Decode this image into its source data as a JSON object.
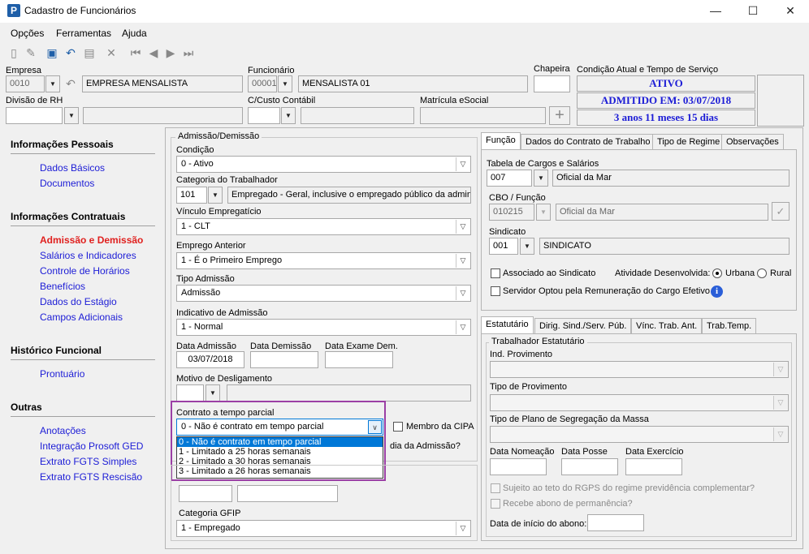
{
  "window": {
    "title": "Cadastro de Funcionários",
    "minimize": "—",
    "maximize": "☐",
    "close": "✕"
  },
  "menu": {
    "opcoes": "Opções",
    "ferramentas": "Ferramentas",
    "ajuda": "Ajuda"
  },
  "header": {
    "empresa_label": "Empresa",
    "empresa_code": "0010",
    "empresa_name": "EMPRESA MENSALISTA",
    "funcionario_label": "Funcionário",
    "funcionario_code": "00001",
    "funcionario_name": "MENSALISTA 01",
    "chapeira_label": "Chapeira",
    "chapeira_value": "",
    "condicao_label": "Condição Atual e Tempo de Serviço",
    "status_ativo": "ATIVO",
    "status_admitido": "ADMITIDO EM: 03/07/2018",
    "status_tempo": "3 anos 11 meses 15 dias",
    "divisao_label": "Divisão de RH",
    "divisao_value": "",
    "custo_label": "C/Custo Contábil",
    "custo_value": "",
    "matricula_label": "Matrícula eSocial",
    "matricula_value": ""
  },
  "sidebar": {
    "sec1": "Informações Pessoais",
    "dados_basicos": "Dados Básicos",
    "documentos": "Documentos",
    "sec2": "Informações Contratuais",
    "admissao": "Admissão e Demissão",
    "salarios": "Salários e Indicadores",
    "horarios": "Controle de Horários",
    "beneficios": "Benefícios",
    "estagio": "Dados do Estágio",
    "campos": "Campos Adicionais",
    "sec3": "Histórico Funcional",
    "prontuario": "Prontuário",
    "sec4": "Outras",
    "anotacoes": "Anotações",
    "integracao": "Integração Prosoft GED",
    "extrato": "Extrato FGTS Simples",
    "extrato_rescisao": "Extrato FGTS Rescisão"
  },
  "admissao": {
    "group_title": "Admissão/Demissão",
    "condicao_label": "Condição",
    "condicao_value": "0 - Ativo",
    "categoria_label": "Categoria do Trabalhador",
    "categoria_code": "101",
    "categoria_desc": "Empregado - Geral, inclusive o empregado público da administ",
    "vinculo_label": "Vínculo Empregatício",
    "vinculo_value": "1 - CLT",
    "emprego_label": "Emprego Anterior",
    "emprego_value": "1 - É o Primeiro Emprego",
    "tipo_label": "Tipo Admissão",
    "tipo_value": "Admissão",
    "indicativo_label": "Indicativo de Admissão",
    "indicativo_value": "1 - Normal",
    "data_adm_label": "Data Admissão",
    "data_adm_value": "03/07/2018",
    "data_dem_label": "Data Demissão",
    "data_dem_value": "",
    "data_exame_label": "Data Exame Dem.",
    "data_exame_value": "",
    "motivo_label": "Motivo de Desligamento",
    "contrato_label": "Contrato a tempo parcial",
    "contrato_value": "0 - Não é contrato em tempo parcial",
    "contrato_options": [
      "0 - Não é contrato em tempo parcial",
      "1 - Limitado a 25 horas semanais",
      "2 - Limitado a 30 horas semanais",
      "3 - Limitado a 26 horas semanais"
    ],
    "membro_cipa": "Membro da CIPA",
    "dia_admissao": "dia da Admissão?",
    "categoria_gfip_label": "Categoria GFIP",
    "categoria_gfip_value": "1 - Empregado"
  },
  "funcao_tabs": {
    "t1": "Função",
    "t2": "Dados do Contrato de Trabalho",
    "t3": "Tipo de Regime",
    "t4": "Observações"
  },
  "funcao": {
    "tabela_label": "Tabela de Cargos e Salários",
    "tabela_code": "007",
    "tabela_desc": "Oficial da Mar",
    "cbo_label": "CBO / Função",
    "cbo_code": "010215",
    "cbo_desc": "Oficial da Mar",
    "sindicato_label": "Sindicato",
    "sindicato_code": "001",
    "sindicato_desc": "SINDICATO",
    "associado": "Associado ao Sindicato",
    "atividade_label": "Atividade Desenvolvida:",
    "urbana": "Urbana",
    "rural": "Rural",
    "servidor": "Servidor Optou pela Remuneração do Cargo Efetivo"
  },
  "estat_tabs": {
    "t1": "Estatutário",
    "t2": "Dirig. Sind./Serv. Púb.",
    "t3": "Vínc. Trab. Ant.",
    "t4": "Trab.Temp."
  },
  "estatutario": {
    "group_title": "Trabalhador Estatutário",
    "ind_label": "Ind. Provimento",
    "tipo_prov_label": "Tipo de Provimento",
    "plano_label": "Tipo de Plano de Segregação da Massa",
    "nomeacao_label": "Data Nomeação",
    "posse_label": "Data Posse",
    "exercicio_label": "Data Exercício",
    "sujeito": "Sujeito ao teto do RGPS do regime previdência complementar?",
    "recebe": "Recebe abono de permanência?",
    "inicio_abono_label": "Data de início do abono:"
  },
  "colors": {
    "link": "#1c1cd6",
    "active_link": "#e0201e",
    "highlight": "#9b3fa5",
    "selection": "#0078d7"
  }
}
